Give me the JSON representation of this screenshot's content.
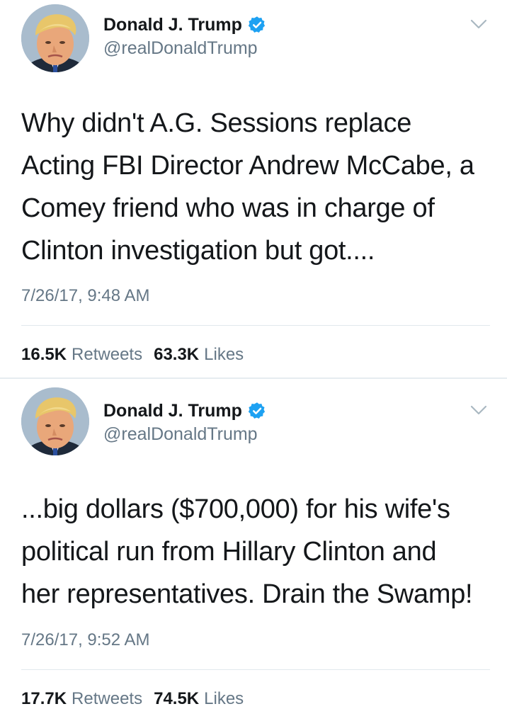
{
  "colors": {
    "verified_badge": "#1da1f2",
    "secondary_text": "#657786",
    "primary_text": "#14171a",
    "divider": "#e6ecf0"
  },
  "icons": {
    "verified": "verified-badge-icon",
    "menu": "chevron-down-icon"
  },
  "tweets": [
    {
      "display_name": "Donald J. Trump",
      "handle": "@realDonaldTrump",
      "text": "Why didn't A.G. Sessions replace\nActing FBI Director Andrew McCabe, a\nComey friend who was in charge of\nClinton investigation but got....",
      "timestamp": "7/26/17, 9:48 AM",
      "retweets_count": "16.5K",
      "retweets_label": "Retweets",
      "likes_count": "63.3K",
      "likes_label": "Likes"
    },
    {
      "display_name": "Donald J. Trump",
      "handle": "@realDonaldTrump",
      "text": "...big dollars ($700,000) for his wife's\npolitical run from Hillary Clinton and\nher representatives. Drain the Swamp!",
      "timestamp": "7/26/17, 9:52 AM",
      "retweets_count": "17.7K",
      "retweets_label": "Retweets",
      "likes_count": "74.5K",
      "likes_label": "Likes"
    }
  ]
}
